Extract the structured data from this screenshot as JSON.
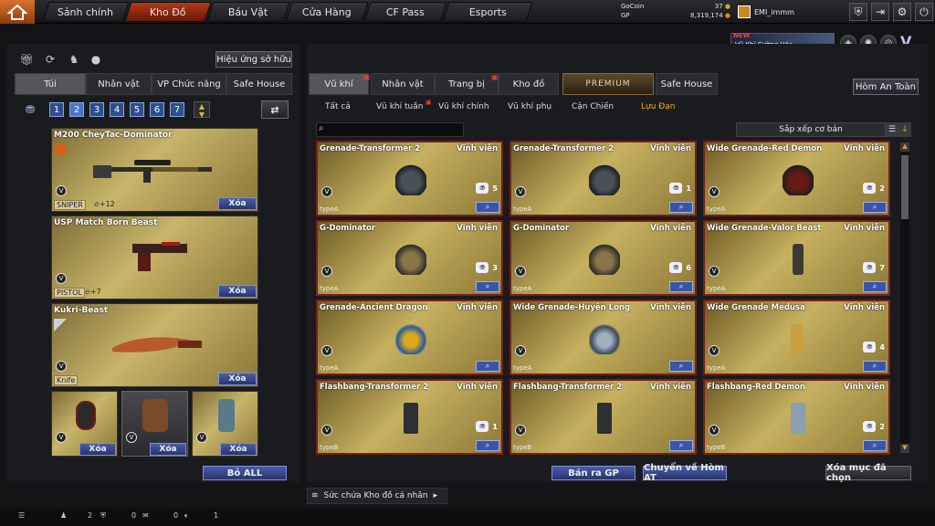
{
  "nav": {
    "tabs": [
      {
        "label": "Sảnh chính"
      },
      {
        "label": "Kho Đồ"
      },
      {
        "label": "Báu Vật"
      },
      {
        "label": "Cửa Hàng"
      },
      {
        "label": "CF Pass"
      },
      {
        "label": "Esports"
      }
    ],
    "gocoin_label": "GoCoin",
    "gocoin_value": "37",
    "gp_label": "GP",
    "gp_value": "8,319,174",
    "username": "EMI_immm"
  },
  "promo": {
    "badge": "NEW",
    "text": "Vũ Khí Cường Hóa"
  },
  "left": {
    "owned_effect": "Hiệu ứng sở hữu",
    "tabs": [
      {
        "label": "Túi"
      },
      {
        "label": "Nhân vật"
      },
      {
        "label": "VP Chức năng"
      },
      {
        "label": "Safe House"
      }
    ],
    "pages": [
      "1",
      "2",
      "3",
      "4",
      "5",
      "6",
      "7"
    ],
    "weapons": [
      {
        "name": "M200 CheyTac-Dominator",
        "tag": "SNIPER",
        "stat": "+12",
        "delete": "Xóa"
      },
      {
        "name": "USP Match Born Beast",
        "tag": "PISTOL",
        "stat": "+7",
        "delete": "Xóa"
      },
      {
        "name": "Kukri-Beast",
        "tag": "Knife",
        "stat": "",
        "delete": "Xóa"
      }
    ],
    "small_delete": "Xóa",
    "remove_all": "Bỏ ALL"
  },
  "right": {
    "tabs": [
      {
        "label": "Vũ khí"
      },
      {
        "label": "Nhân vật"
      },
      {
        "label": "Trang bị"
      },
      {
        "label": "Kho đồ"
      },
      {
        "label": "PREMIUM"
      },
      {
        "label": "Safe House"
      }
    ],
    "safe_box": "Hòm An Toàn",
    "subtabs": [
      {
        "label": "Tất cả"
      },
      {
        "label": "Vũ khí tuần"
      },
      {
        "label": "Vũ khí chính"
      },
      {
        "label": "Vũ khí phụ"
      },
      {
        "label": "Cận Chiến"
      },
      {
        "label": "Lựu Đạn"
      }
    ],
    "sort_label": "Sắp xếp cơ bản",
    "items": [
      {
        "name": "Grenade-Transformer 2",
        "perm": "Vĩnh viễn",
        "count": "5",
        "type": "typeA"
      },
      {
        "name": "Grenade-Transformer 2",
        "perm": "Vĩnh viễn",
        "count": "1",
        "type": "typeA"
      },
      {
        "name": "Wide Grenade-Red Demon",
        "perm": "Vĩnh viễn",
        "count": "2",
        "type": "typeA"
      },
      {
        "name": "G-Dominator",
        "perm": "Vĩnh viễn",
        "count": "3",
        "type": "typeA"
      },
      {
        "name": "G-Dominator",
        "perm": "Vĩnh viễn",
        "count": "6",
        "type": "typeA"
      },
      {
        "name": "Wide Grenade-Valor Beast",
        "perm": "Vĩnh viễn",
        "count": "7",
        "type": "typeA"
      },
      {
        "name": "Grenade-Ancient Dragon",
        "perm": "Vĩnh viễn",
        "count": "",
        "type": "typeA"
      },
      {
        "name": "Wide Grenade-Huyền Long",
        "perm": "Vĩnh viễn",
        "count": "",
        "type": "typeA"
      },
      {
        "name": "Wide Grenade Medusa",
        "perm": "Vĩnh viễn",
        "count": "4",
        "type": "typeA"
      },
      {
        "name": "Flashbang-Transformer 2",
        "perm": "Vĩnh viễn",
        "count": "1",
        "type": "typeB"
      },
      {
        "name": "Flashbang-Transformer 2",
        "perm": "Vĩnh viễn",
        "count": "",
        "type": "typeB"
      },
      {
        "name": "Flashbang-Red Demon",
        "perm": "Vĩnh viễn",
        "count": "2",
        "type": "typeB"
      }
    ],
    "sell_gp": "Bán ra GP",
    "move_safe": "Chuyển về Hòm AT",
    "delete_selected": "Xóa mục đã chọn"
  },
  "capacity": "Sức chứa Kho đồ cá nhân",
  "status": {
    "a": "2",
    "b": "0",
    "c": "0",
    "d": "1"
  }
}
